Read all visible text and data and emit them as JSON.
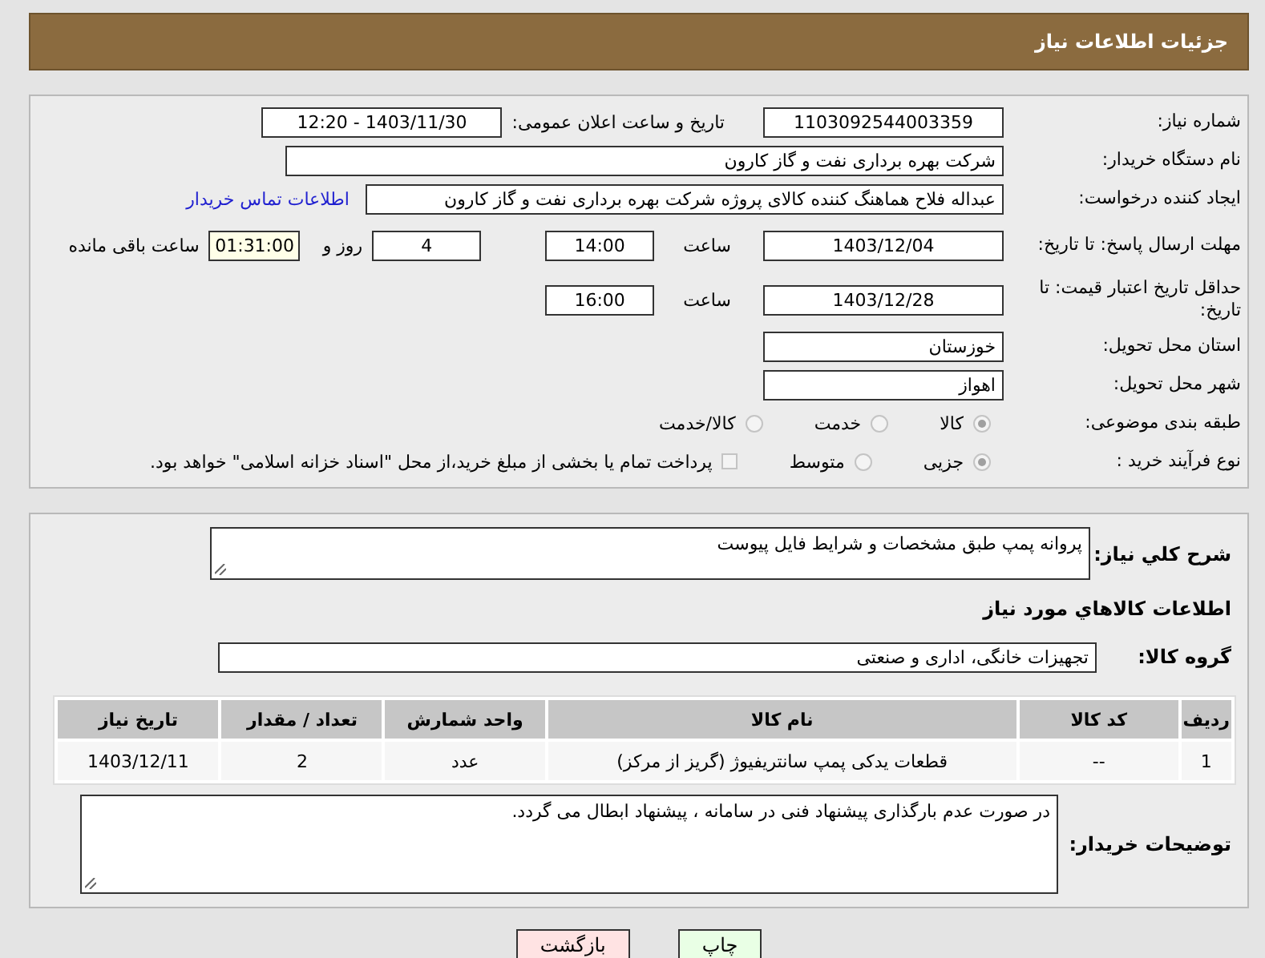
{
  "header": {
    "title": "جزئیات اطلاعات نیاز"
  },
  "need_number": {
    "label": "شماره نیاز:",
    "value": "1103092544003359"
  },
  "announce": {
    "label": "تاریخ و ساعت اعلان عمومی:",
    "value": "1403/11/30 - 12:20"
  },
  "buyer_org": {
    "label": "نام دستگاه خریدار:",
    "value": "شرکت بهره برداری نفت و گاز کارون"
  },
  "requester": {
    "label": "ایجاد کننده درخواست:",
    "value": "عبداله فلاح هماهنگ کننده کالای پروژه شرکت بهره برداری نفت و گاز کارون",
    "link": "اطلاعات تماس خریدار"
  },
  "reply_deadline": {
    "label": "مهلت ارسال پاسخ: تا تاریخ:",
    "date": "1403/12/04",
    "time_label": "ساعت",
    "time": "14:00",
    "days": "4",
    "days_label": "روز و",
    "remaining": "01:31:00",
    "remaining_label": "ساعت باقی مانده"
  },
  "price_validity": {
    "label": "حداقل تاریخ اعتبار قیمت: تا تاریخ:",
    "date": "1403/12/28",
    "time_label": "ساعت",
    "time": "16:00"
  },
  "province": {
    "label": "استان محل تحویل:",
    "value": "خوزستان"
  },
  "city": {
    "label": "شهر محل تحویل:",
    "value": "اهواز"
  },
  "category": {
    "label": "طبقه بندی موضوعی:",
    "options": [
      {
        "label": "کالا",
        "selected": true
      },
      {
        "label": "خدمت",
        "selected": false
      },
      {
        "label": "کالا/خدمت",
        "selected": false
      }
    ]
  },
  "purchase_type": {
    "label": "نوع فرآیند خرید :",
    "options": [
      {
        "label": "جزیی",
        "selected": true
      },
      {
        "label": "متوسط",
        "selected": false
      }
    ],
    "payment_note": {
      "checked": false,
      "text": "پرداخت تمام یا بخشی از مبلغ خرید،از محل \"اسناد خزانه اسلامی\" خواهد بود."
    }
  },
  "description": {
    "label": "شرح کلي نیاز:",
    "value": "پروانه پمپ طبق مشخصات و شرایط فایل پیوست"
  },
  "goods_heading": "اطلاعات کالاهاي مورد نیاز",
  "goods_group": {
    "label": "گروه کالا:",
    "value": "تجهیزات خانگی، اداری و صنعتی"
  },
  "table": {
    "columns": [
      "ردیف",
      "کد کالا",
      "نام کالا",
      "واحد شمارش",
      "تعداد / مقدار",
      "تاریخ نیاز"
    ],
    "rows": [
      [
        "1",
        "--",
        "قطعات یدکی پمپ سانتریفیوژ (گریز از مرکز)",
        "عدد",
        "2",
        "1403/12/11"
      ]
    ]
  },
  "buyer_notes": {
    "label": "توضیحات خریدار:",
    "value": "در صورت عدم بارگذاری پیشنهاد فنی در سامانه ، پیشنهاد ابطال می گردد."
  },
  "buttons": [
    {
      "label": "چاپ",
      "kind": "print"
    },
    {
      "label": "بازگشت",
      "kind": "back"
    }
  ]
}
